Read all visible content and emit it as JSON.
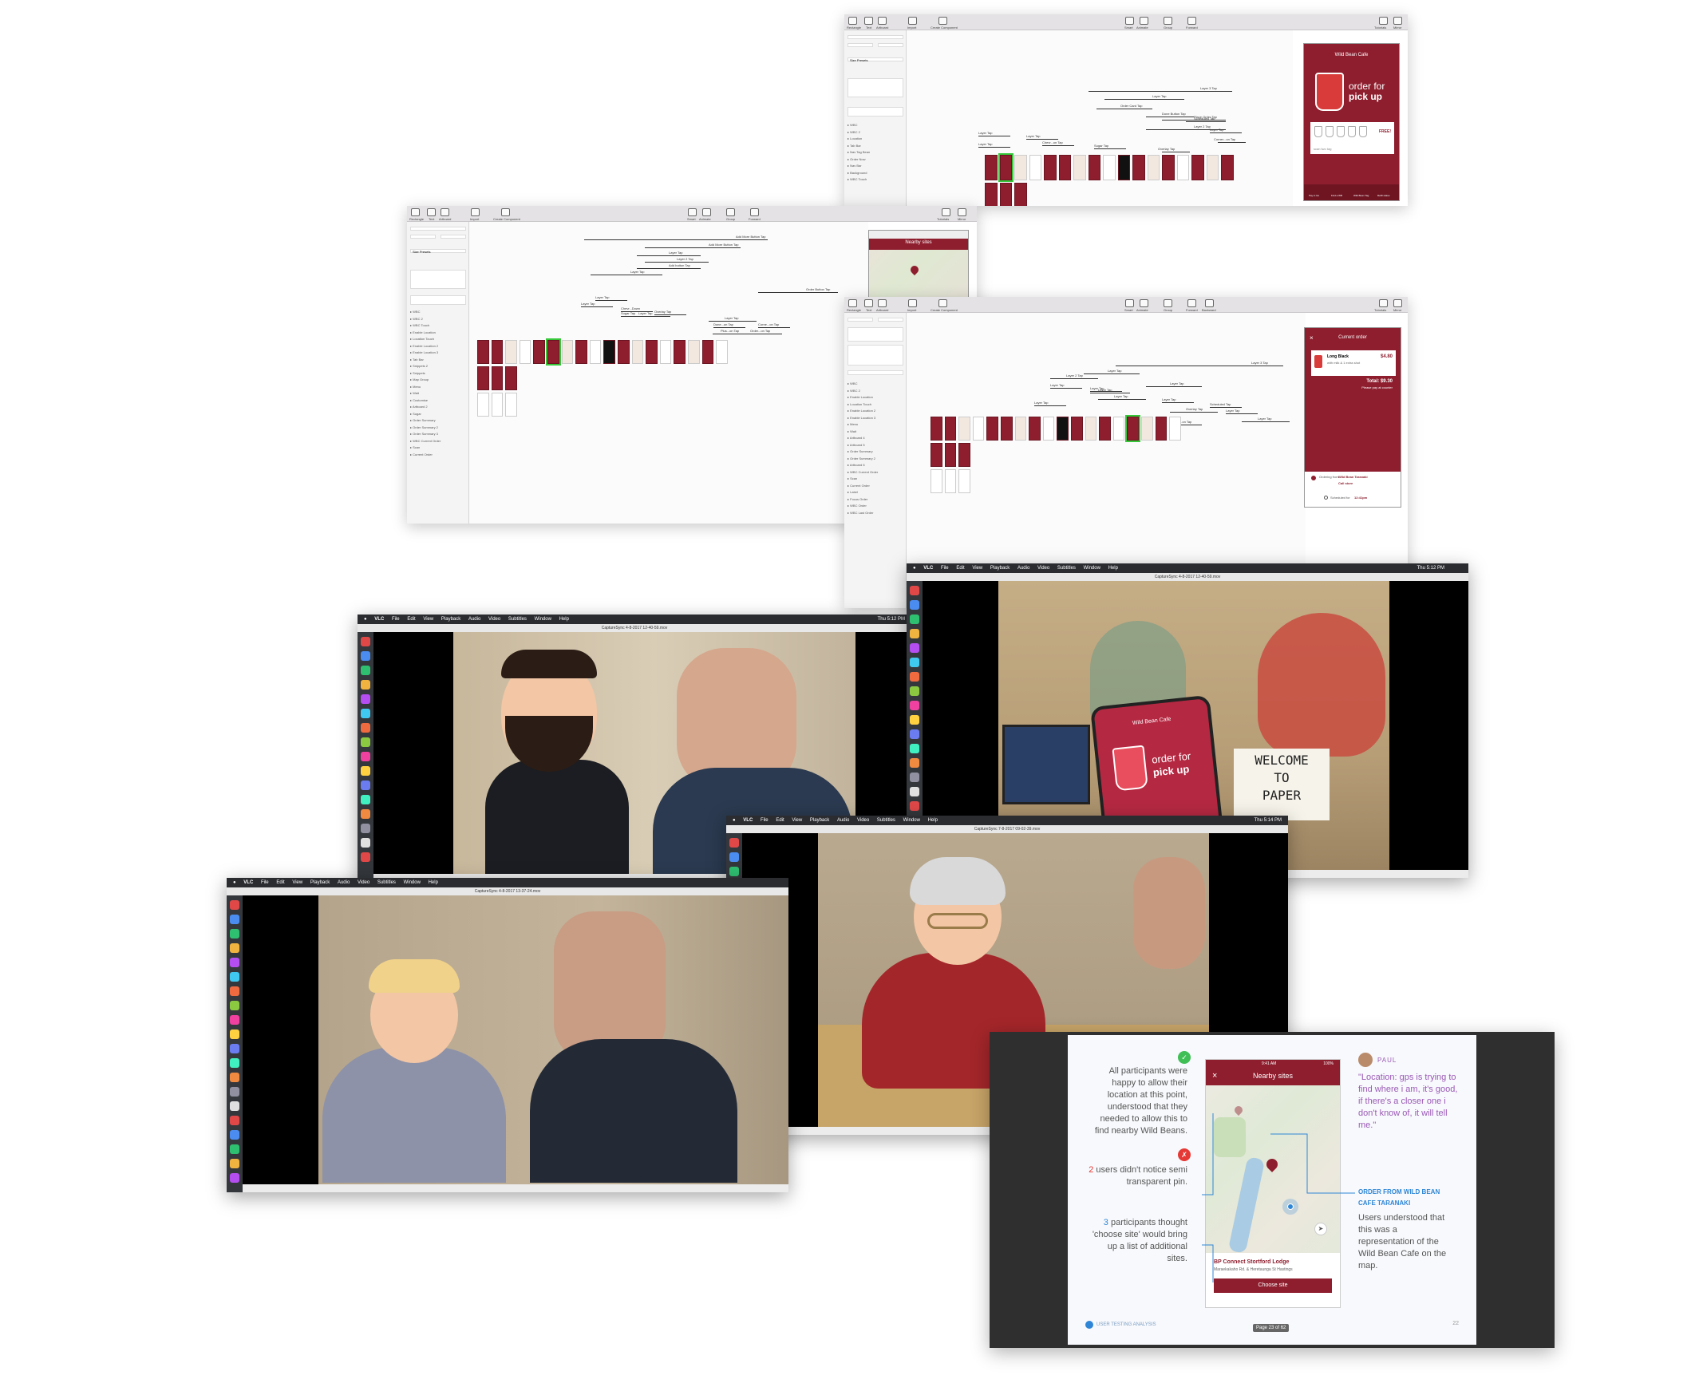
{
  "sketch": {
    "toolbar": [
      "Rectangle",
      "Text",
      "Artboard",
      "Import",
      "Create Component",
      "Smart",
      "Animate",
      "Group",
      "Forward",
      "Backward",
      "Tutorials",
      "Mirror"
    ],
    "inspector": {
      "size_presets": "Size Presets",
      "width": "Width",
      "height": "Height"
    },
    "win1": {
      "layers": [
        "WBC",
        "WBC 2",
        "Location",
        "Tab Bar",
        "Nav Tag Bean",
        "Order Now",
        "Nav Bar",
        "Background",
        "WBC Touch"
      ],
      "links": [
        "Layer 3 Tap",
        "Layer Tap",
        "Order Card Tap",
        "Done Button Tap",
        "Place Order Tap",
        "Layer 2 Tap",
        "Layer Tap",
        "Layer Tap",
        "Chevr...on Tap",
        "Sugar Tap",
        "Overlay Tap",
        "Layer Tap",
        "Layer Tap",
        "Scheduled Tap",
        "Corner...on Tap"
      ],
      "phone": {
        "title": "Wild Bean Cafe",
        "headline_1": "order for",
        "headline_2": "pick up",
        "badge": "FREE!",
        "footer_note": "scan two tag",
        "tabs": [
          "Pay in Go",
          "Find a WB",
          "Wild Bean Tag",
          "Refill status"
        ]
      }
    },
    "win2": {
      "layers": [
        "WBC",
        "WBC 2",
        "WBC Touch",
        "Enable Location",
        "Location Touch",
        "Enable Location 2",
        "Enable Location 3",
        "Tab Bar",
        "Snippets 2",
        "Snippets",
        "Map Group",
        "Menu",
        "Wait",
        "Customise",
        "Artboard 2",
        "Sugar",
        "Order Summary",
        "Order Summary 2",
        "Order Summary 3",
        "WBC Current Order",
        "Scan",
        "Current Order"
      ],
      "links": [
        "Add More Button Tap",
        "Add More Button Tap",
        "Layer Tap",
        "Layer 2 Tap",
        "Add button Tap",
        "Layer Tap",
        "Order Button Tap",
        "Layer Tap",
        "Layer Tap",
        "Chevr...Down",
        "Layer Tap",
        "Sugar Tap",
        "Overlay Tap",
        "Layer Tap",
        "Done...on Tap",
        "Plus...on Tap",
        "Corne...on Tap",
        "Order...on Tap"
      ],
      "phone": {
        "title": "Nearby sites"
      }
    },
    "win3": {
      "layers": [
        "WBC",
        "WBC 2",
        "Enable Location",
        "Location Touch",
        "Enable Location 2",
        "Enable Location 3",
        "Menu",
        "Wait",
        "Artboard 4",
        "Artboard 5",
        "Order Summary",
        "Order Summary 2",
        "Artboard 6",
        "WBC Current Order",
        "Scan",
        "Current Order",
        "Label",
        "Focus Order",
        "WBC Order",
        "WBC Last Order"
      ],
      "links": [
        "Layer 3 Tap",
        "Layer Tap",
        "Layer 2 Tap",
        "Layer Tap",
        "Layer Tap",
        "Layer Tap",
        "Layer Tap",
        "Overlay Tap",
        "Layer Tap",
        "Layer Tap",
        "Layer Tap",
        "Scheduled Tap",
        "Layer Tap",
        "Layer Tap",
        "Corner...on Tap"
      ],
      "phone": {
        "title": "Current order",
        "item": "Long Black",
        "item_detail": "with milk & 1 extra shot",
        "price": "$4.80",
        "total": "Total: $9.30",
        "pay_note": "Please pay at counter",
        "ordering_from_prefix": "Ordering from",
        "ordering_from_store": "Wild Bean Taranaki",
        "call_store": "Call store",
        "scheduled_prefix": "Scheduled for",
        "scheduled_time": "12:41pm"
      }
    }
  },
  "vlc": {
    "menu": [
      "VLC",
      "File",
      "Edit",
      "View",
      "Playback",
      "Audio",
      "Video",
      "Subtitles",
      "Window",
      "Help"
    ],
    "windows": [
      {
        "title": "CaptureSync 4-8-2017 12-40-59.mov",
        "clock": "Thu 5:12 PM"
      },
      {
        "title": "CaptureSync 4-8-2017 12-40-59.mov",
        "clock": "Thu 5:12 PM",
        "wall_sign_1": "WELCOME",
        "wall_sign_2": "TO",
        "wall_sign_3": "PAPER",
        "phone_title": "Wild Bean Cafe",
        "phone_headline_1": "order for",
        "phone_headline_2": "pick up"
      },
      {
        "title": "CaptureSync 7-8-2017 09-02-39.mov",
        "clock": "Thu 5:14 PM"
      },
      {
        "title": "CaptureSync 4-8-2017 13-37-24.mov",
        "clock": ""
      }
    ]
  },
  "slide": {
    "left_1": "All participants were happy to allow their location at this point, understood that they needed to allow this to find nearby Wild Beans.",
    "left_2_count": "2",
    "left_2": " users didn't notice semi transparent pin.",
    "left_3_count": "3",
    "left_3": " participants thought 'choose site' would bring up a list of additional sites.",
    "phone": {
      "status_time": "9:41 AM",
      "status_battery": "100%",
      "title": "Nearby sites",
      "site_name": "BP Connect Stortford Lodge",
      "site_address": "Maraekakaho Rd. & Heretaunga St Hastings",
      "button": "Choose site"
    },
    "quote_author": "PAUL",
    "quote": "\"Location: gps is trying to find where i am, it's good, if there's a closer one i don't know of, it will tell me.\"",
    "callout_title": "ORDER FROM WILD BEAN CAFE TARANAKI",
    "callout_text": "Users understood that this was a representation of the Wild Bean Cafe on the map.",
    "footer_label": "USER TESTING ANALYSIS",
    "page_indicator": "Page 23 of 62",
    "page_number": "22",
    "colors": {
      "accent": "#8e1e2e",
      "quote": "#9b59b6",
      "callout": "#2f86d6",
      "positive": "#3fbf55",
      "negative": "#e53935"
    }
  }
}
